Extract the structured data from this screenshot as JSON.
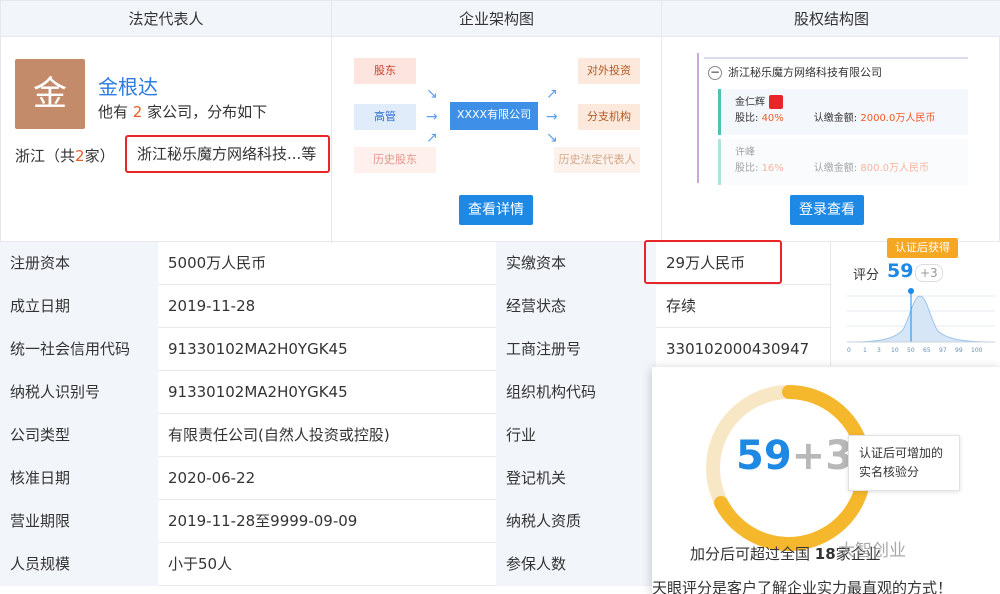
{
  "headers": {
    "legal_rep": "法定代表人",
    "org_chart": "企业架构图",
    "equity_chart": "股权结构图"
  },
  "legal_rep": {
    "avatar_char": "金",
    "name": "金根达",
    "sub_pre": "他有 ",
    "company_count": "2",
    "sub_post": " 家公司，分布如下",
    "region_pre": "浙江（共",
    "region_count": "2",
    "region_post": "家）",
    "company_link": "浙江秘乐魔方网络科技...等"
  },
  "org_chart": {
    "left": [
      "股东",
      "高管",
      "历史股东"
    ],
    "center": "XXXX有限公司",
    "right": [
      "对外投资",
      "分支机构",
      "历史法定代表人"
    ],
    "button": "查看详情"
  },
  "equity_chart": {
    "root": "浙江秘乐魔方网络科技有限公司",
    "holder1_name": "金仁辉",
    "holder1_ratio_label": "股比:",
    "holder1_ratio": "40%",
    "holder1_amount_label": "认缴金额:",
    "holder1_amount": "2000.0万人民币",
    "holder2_name": "许峰",
    "holder2_ratio_label": "股比:",
    "holder2_ratio": "16%",
    "holder2_amount_label": "认缴金额:",
    "holder2_amount": "800.0万人民币",
    "button": "登录查看"
  },
  "table": [
    {
      "k1": "注册资本",
      "v1": "5000万人民币",
      "k2": "实缴资本",
      "v2": "29万人民币"
    },
    {
      "k1": "成立日期",
      "v1": "2019-11-28",
      "k2": "经营状态",
      "v2": "存续"
    },
    {
      "k1": "统一社会信用代码",
      "v1": "91330102MA2H0YGK45",
      "k2": "工商注册号",
      "v2": "330102000430947"
    },
    {
      "k1": "纳税人识别号",
      "v1": "91330102MA2H0YGK45",
      "k2": "组织机构代码",
      "v2": ""
    },
    {
      "k1": "公司类型",
      "v1": "有限责任公司(自然人投资或控股)",
      "k2": "行业",
      "v2": ""
    },
    {
      "k1": "核准日期",
      "v1": "2020-06-22",
      "k2": "登记机关",
      "v2": ""
    },
    {
      "k1": "营业期限",
      "v1": "2019-11-28至9999-09-09",
      "k2": "纳税人资质",
      "v2": ""
    },
    {
      "k1": "人员规模",
      "v1": "小于50人",
      "k2": "参保人数",
      "v2": ""
    }
  ],
  "score": {
    "badge": "认证后获得",
    "label": "评分",
    "value": "59",
    "plus": "+3",
    "axis": [
      "0",
      "1",
      "3",
      "10",
      "50",
      "65",
      "97",
      "99",
      "100"
    ]
  },
  "popover": {
    "score": "59",
    "plus": "+3",
    "tip_line1": "认证后可增加的",
    "tip_line2": "实名核验分",
    "line1_pre": "加分后可超过全国 ",
    "line1_num": "18",
    "line1_post": "家企业",
    "line2": "天眼评分是客户了解企业实力最直观的方式！"
  },
  "watermark": "大智创业",
  "colors": {
    "accent": "#1e88e5",
    "highlight": "#e8262a",
    "orange": "#f05a28",
    "gold": "#f5a623"
  }
}
